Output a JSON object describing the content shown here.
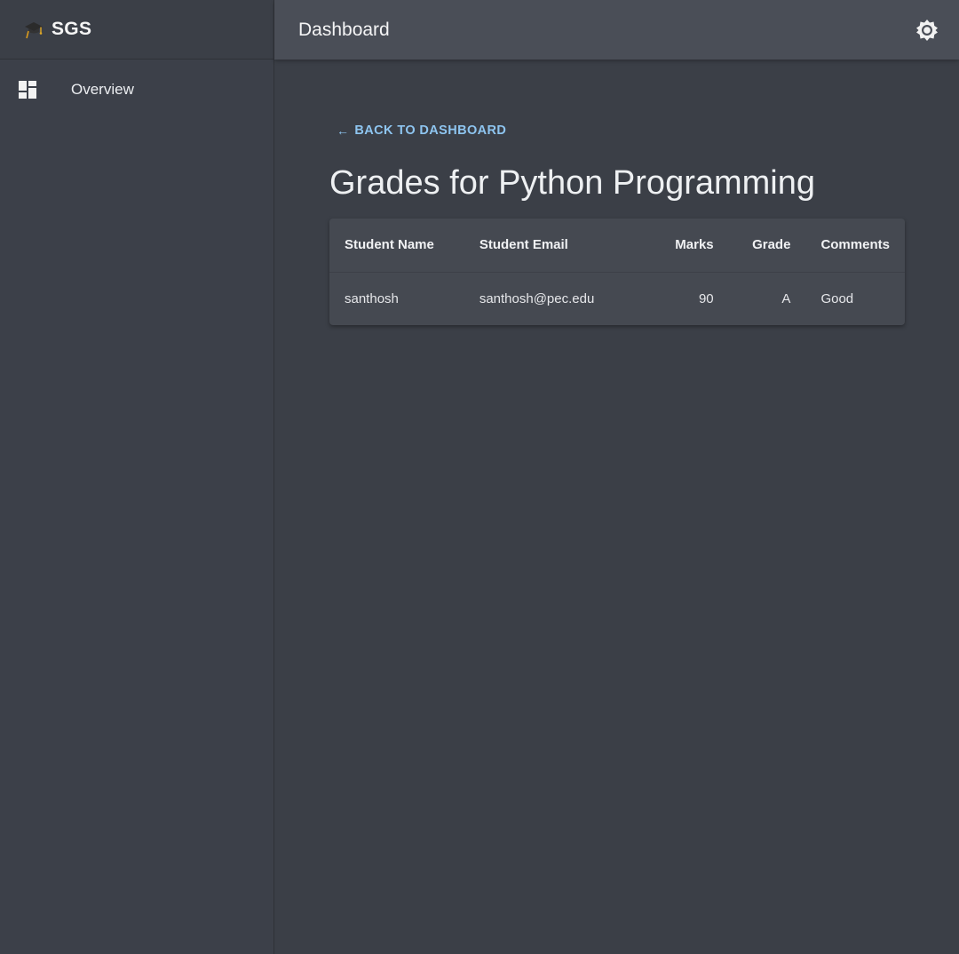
{
  "brand": {
    "title": "SGS",
    "icon": "graduation-cap-icon"
  },
  "sidebar": {
    "items": [
      {
        "label": "Overview",
        "icon": "dashboard-icon"
      }
    ]
  },
  "appbar": {
    "title": "Dashboard",
    "theme_icon": "brightness-icon"
  },
  "main": {
    "back_link": {
      "arrow": "←",
      "label": "BACK TO DASHBOARD"
    },
    "title": "Grades for Python Programming",
    "table": {
      "headers": [
        "Student Name",
        "Student Email",
        "Marks",
        "Grade",
        "Comments"
      ],
      "rows": [
        {
          "name": "santhosh",
          "email": "santhosh@pec.edu",
          "marks": "90",
          "grade": "A",
          "comments": "Good"
        }
      ]
    }
  },
  "colors": {
    "accent_link": "#8ec5f0",
    "background": "#3b3f47",
    "appbar": "#4a4e57",
    "card": "#454951"
  }
}
